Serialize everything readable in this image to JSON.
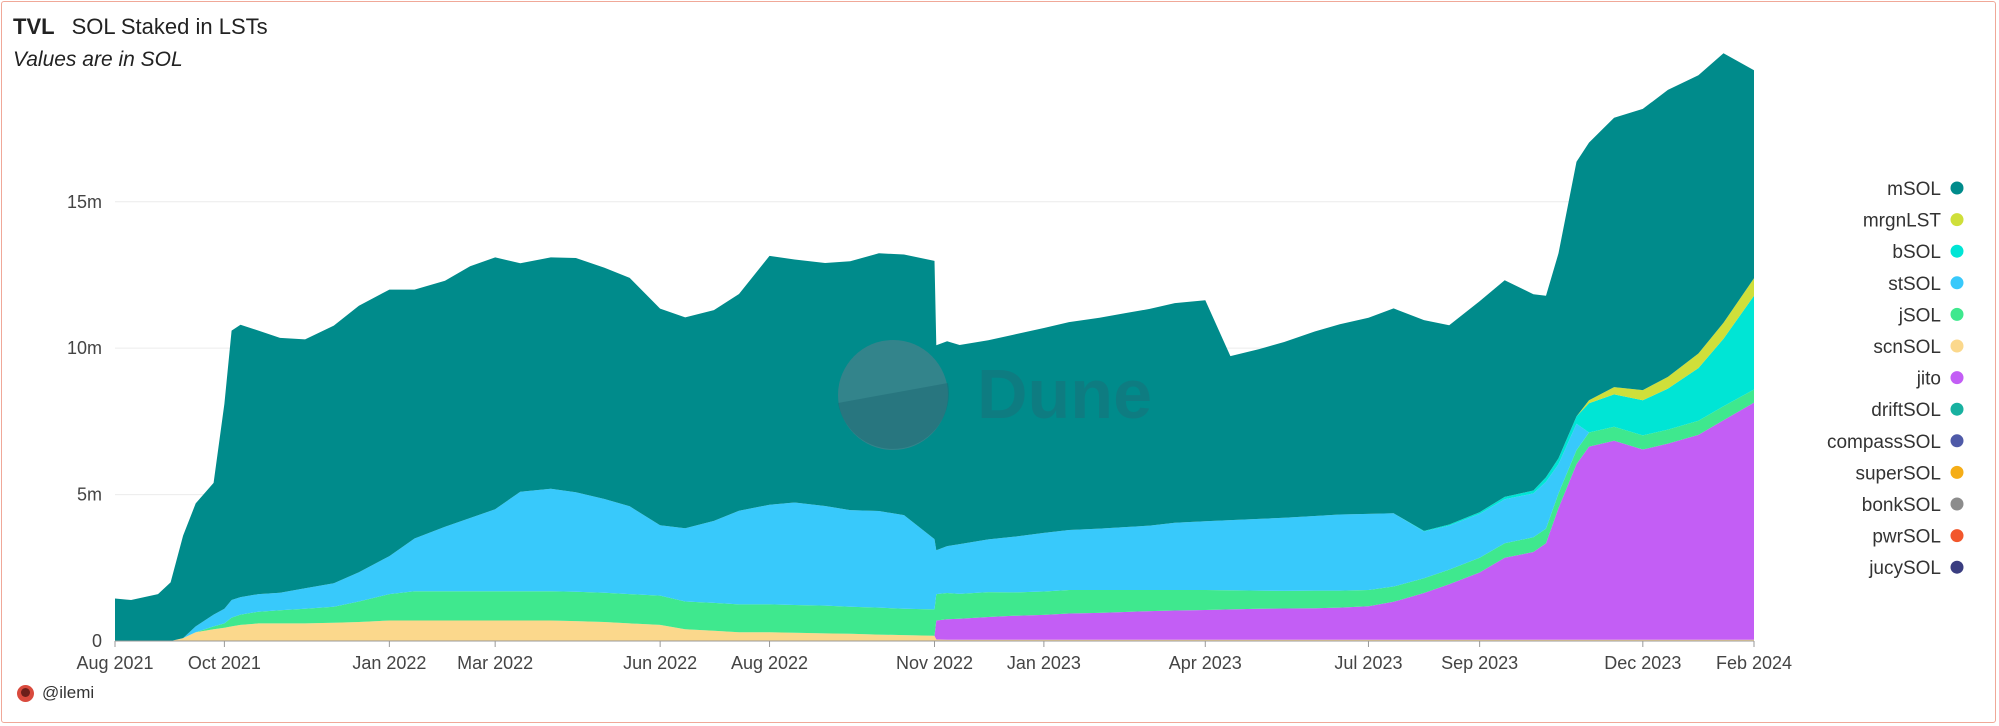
{
  "header": {
    "title_tag": "TVL",
    "title": "SOL Staked in LSTs",
    "subtitle": "Values are in SOL"
  },
  "author": {
    "handle": "@ilemi"
  },
  "watermark": {
    "text": "Dune"
  },
  "colors": {
    "mSOL": "#008b8b",
    "mrgnLST": "#cfdf3a",
    "bSOL": "#00e5d5",
    "stSOL": "#38c9fb",
    "jSOL": "#3fe88e",
    "scnSOL": "#fbd88c",
    "jito": "#c35ef5",
    "driftSOL": "#18b1a0",
    "compassSOL": "#4f5aa8",
    "superSOL": "#f5ad17",
    "bonkSOL": "#8c8c8c",
    "pwrSOL": "#f2572c",
    "jucySOL": "#3a3d80"
  },
  "chart_data": {
    "type": "area",
    "stacked": true,
    "title": "SOL Staked in LSTs",
    "subtitle": "Values are in SOL",
    "ylabel": "",
    "xlabel": "",
    "unit": "SOL",
    "ylim": [
      0,
      19500000
    ],
    "y_ticks": [
      0,
      5000000,
      10000000,
      15000000
    ],
    "y_tick_labels": [
      "0",
      "5m",
      "10m",
      "15m"
    ],
    "x_tick_labels": [
      "Aug 2021",
      "Oct 2021",
      "Jan 2022",
      "Mar 2022",
      "Jun 2022",
      "Aug 2022",
      "Nov 2022",
      "Jan 2023",
      "Apr 2023",
      "Jul 2023",
      "Sep 2023",
      "Dec 2023",
      "Feb 2024"
    ],
    "x_tick_dates": [
      "2021-08-01",
      "2021-10-01",
      "2022-01-01",
      "2022-03-01",
      "2022-06-01",
      "2022-08-01",
      "2022-11-01",
      "2023-01-01",
      "2023-04-01",
      "2023-07-01",
      "2023-09-01",
      "2023-12-01",
      "2024-02-01"
    ],
    "grid": true,
    "legend_position": "right",
    "x": [
      "2021-08-01",
      "2021-08-10",
      "2021-08-25",
      "2021-09-01",
      "2021-09-08",
      "2021-09-15",
      "2021-09-25",
      "2021-10-01",
      "2021-10-05",
      "2021-10-10",
      "2021-10-20",
      "2021-11-01",
      "2021-11-15",
      "2021-12-01",
      "2021-12-15",
      "2022-01-01",
      "2022-01-15",
      "2022-02-01",
      "2022-02-15",
      "2022-03-01",
      "2022-03-15",
      "2022-04-01",
      "2022-04-15",
      "2022-05-01",
      "2022-05-15",
      "2022-06-01",
      "2022-06-15",
      "2022-07-01",
      "2022-07-15",
      "2022-08-01",
      "2022-08-15",
      "2022-09-01",
      "2022-09-15",
      "2022-10-01",
      "2022-10-15",
      "2022-11-01",
      "2022-11-02",
      "2022-11-08",
      "2022-11-15",
      "2022-12-01",
      "2022-12-15",
      "2023-01-01",
      "2023-01-15",
      "2023-02-01",
      "2023-02-15",
      "2023-03-01",
      "2023-03-15",
      "2023-04-01",
      "2023-04-15",
      "2023-05-01",
      "2023-05-15",
      "2023-06-01",
      "2023-06-15",
      "2023-07-01",
      "2023-07-15",
      "2023-08-01",
      "2023-08-15",
      "2023-09-01",
      "2023-09-15",
      "2023-10-01",
      "2023-10-08",
      "2023-10-15",
      "2023-10-25",
      "2023-11-01",
      "2023-11-15",
      "2023-12-01",
      "2023-12-15",
      "2024-01-01",
      "2024-01-15",
      "2024-02-01"
    ],
    "series": [
      {
        "name": "scnSOL",
        "values": [
          0,
          0,
          0,
          0,
          0.1,
          0.3,
          0.4,
          0.45,
          0.5,
          0.55,
          0.6,
          0.6,
          0.6,
          0.62,
          0.65,
          0.7,
          0.7,
          0.7,
          0.7,
          0.7,
          0.7,
          0.7,
          0.68,
          0.65,
          0.6,
          0.55,
          0.4,
          0.35,
          0.3,
          0.3,
          0.28,
          0.26,
          0.25,
          0.22,
          0.2,
          0.18,
          0.05,
          0.04,
          0.04,
          0.04,
          0.04,
          0.04,
          0.04,
          0.04,
          0.04,
          0.04,
          0.04,
          0.04,
          0.04,
          0.04,
          0.04,
          0.04,
          0.04,
          0.04,
          0.04,
          0.04,
          0.04,
          0.04,
          0.04,
          0.04,
          0.04,
          0.04,
          0.04,
          0.04,
          0.04,
          0.04,
          0.04,
          0.04,
          0.04,
          0.04
        ]
      },
      {
        "name": "jito",
        "values": [
          0,
          0,
          0,
          0,
          0,
          0,
          0,
          0,
          0,
          0,
          0,
          0,
          0,
          0,
          0,
          0,
          0,
          0,
          0,
          0,
          0,
          0,
          0,
          0,
          0,
          0,
          0,
          0,
          0,
          0,
          0,
          0,
          0,
          0,
          0,
          0,
          0.65,
          0.7,
          0.72,
          0.78,
          0.82,
          0.85,
          0.9,
          0.92,
          0.95,
          0.98,
          1.0,
          1.02,
          1.04,
          1.06,
          1.07,
          1.08,
          1.1,
          1.15,
          1.3,
          1.6,
          1.9,
          2.3,
          2.8,
          3.0,
          3.3,
          4.5,
          6.0,
          6.6,
          6.8,
          6.5,
          6.7,
          7.0,
          7.5,
          8.1
        ]
      },
      {
        "name": "jSOL",
        "values": [
          0,
          0,
          0,
          0,
          0,
          0,
          0.1,
          0.15,
          0.3,
          0.35,
          0.4,
          0.45,
          0.5,
          0.55,
          0.7,
          0.9,
          1.0,
          1.0,
          1.0,
          1.0,
          1.0,
          1.0,
          1.0,
          1.0,
          1.0,
          1.0,
          0.95,
          0.95,
          0.95,
          0.95,
          0.95,
          0.95,
          0.92,
          0.92,
          0.9,
          0.9,
          0.9,
          0.9,
          0.85,
          0.85,
          0.8,
          0.8,
          0.8,
          0.78,
          0.75,
          0.72,
          0.7,
          0.68,
          0.65,
          0.62,
          0.6,
          0.6,
          0.58,
          0.55,
          0.52,
          0.5,
          0.5,
          0.5,
          0.5,
          0.5,
          0.5,
          0.5,
          0.48,
          0.48,
          0.48,
          0.48,
          0.48,
          0.48,
          0.48,
          0.45
        ]
      },
      {
        "name": "stSOL",
        "values": [
          0,
          0,
          0,
          0,
          0,
          0.2,
          0.4,
          0.5,
          0.6,
          0.6,
          0.6,
          0.6,
          0.7,
          0.8,
          1.0,
          1.3,
          1.8,
          2.2,
          2.5,
          2.8,
          3.4,
          3.5,
          3.4,
          3.2,
          3.0,
          2.4,
          2.5,
          2.8,
          3.2,
          3.4,
          3.5,
          3.4,
          3.3,
          3.3,
          3.2,
          2.4,
          1.5,
          1.6,
          1.7,
          1.8,
          1.9,
          2.0,
          2.05,
          2.1,
          2.15,
          2.2,
          2.3,
          2.35,
          2.4,
          2.45,
          2.5,
          2.55,
          2.6,
          2.6,
          2.5,
          1.6,
          1.5,
          1.5,
          1.5,
          1.5,
          1.6,
          1.0,
          0.9,
          0.0,
          0.0,
          0.0,
          0.0,
          0.0,
          0.0,
          0.0
        ]
      },
      {
        "name": "bSOL",
        "values": [
          0,
          0,
          0,
          0,
          0,
          0,
          0,
          0,
          0,
          0,
          0,
          0,
          0,
          0,
          0,
          0,
          0,
          0,
          0,
          0,
          0,
          0,
          0,
          0,
          0,
          0,
          0,
          0,
          0,
          0,
          0,
          0,
          0,
          0,
          0,
          0,
          0,
          0,
          0,
          0,
          0,
          0,
          0,
          0,
          0,
          0,
          0,
          0,
          0,
          0,
          0,
          0,
          0,
          0,
          0,
          0.02,
          0.04,
          0.06,
          0.08,
          0.1,
          0.15,
          0.2,
          0.25,
          1.0,
          1.1,
          1.2,
          1.4,
          1.8,
          2.3,
          3.2
        ]
      },
      {
        "name": "mrgnLST",
        "values": [
          0,
          0,
          0,
          0,
          0,
          0,
          0,
          0,
          0,
          0,
          0,
          0,
          0,
          0,
          0,
          0,
          0,
          0,
          0,
          0,
          0,
          0,
          0,
          0,
          0,
          0,
          0,
          0,
          0,
          0,
          0,
          0,
          0,
          0,
          0,
          0,
          0,
          0,
          0,
          0,
          0,
          0,
          0,
          0,
          0,
          0,
          0,
          0,
          0,
          0,
          0,
          0,
          0,
          0,
          0,
          0,
          0,
          0,
          0,
          0,
          0,
          0,
          0,
          0.1,
          0.25,
          0.35,
          0.4,
          0.5,
          0.55,
          0.6
        ]
      },
      {
        "name": "mSOL",
        "values": [
          1.45,
          1.4,
          1.6,
          2.0,
          3.5,
          4.2,
          4.5,
          7.0,
          9.2,
          9.3,
          9.0,
          8.7,
          8.5,
          8.8,
          9.1,
          9.1,
          8.5,
          8.4,
          8.6,
          8.6,
          7.8,
          7.9,
          8.0,
          7.9,
          7.8,
          7.4,
          7.2,
          7.2,
          7.4,
          8.5,
          8.3,
          8.3,
          8.5,
          8.8,
          8.9,
          9.5,
          7.0,
          7.0,
          6.8,
          6.8,
          6.9,
          7.0,
          7.1,
          7.2,
          7.3,
          7.4,
          7.5,
          7.55,
          5.6,
          5.8,
          6.0,
          6.3,
          6.5,
          6.7,
          7.0,
          7.2,
          6.8,
          7.2,
          7.4,
          6.7,
          6.2,
          7.0,
          8.7,
          8.8,
          9.2,
          9.6,
          9.8,
          9.5,
          9.2,
          7.1
        ]
      },
      {
        "name": "driftSOL",
        "values": []
      },
      {
        "name": "compassSOL",
        "values": []
      },
      {
        "name": "superSOL",
        "values": []
      },
      {
        "name": "bonkSOL",
        "values": []
      },
      {
        "name": "pwrSOL",
        "values": []
      },
      {
        "name": "jucySOL",
        "values": []
      }
    ],
    "values_unit_note": "millions"
  },
  "legend": [
    "mSOL",
    "mrgnLST",
    "bSOL",
    "stSOL",
    "jSOL",
    "scnSOL",
    "jito",
    "driftSOL",
    "compassSOL",
    "superSOL",
    "bonkSOL",
    "pwrSOL",
    "jucySOL"
  ]
}
